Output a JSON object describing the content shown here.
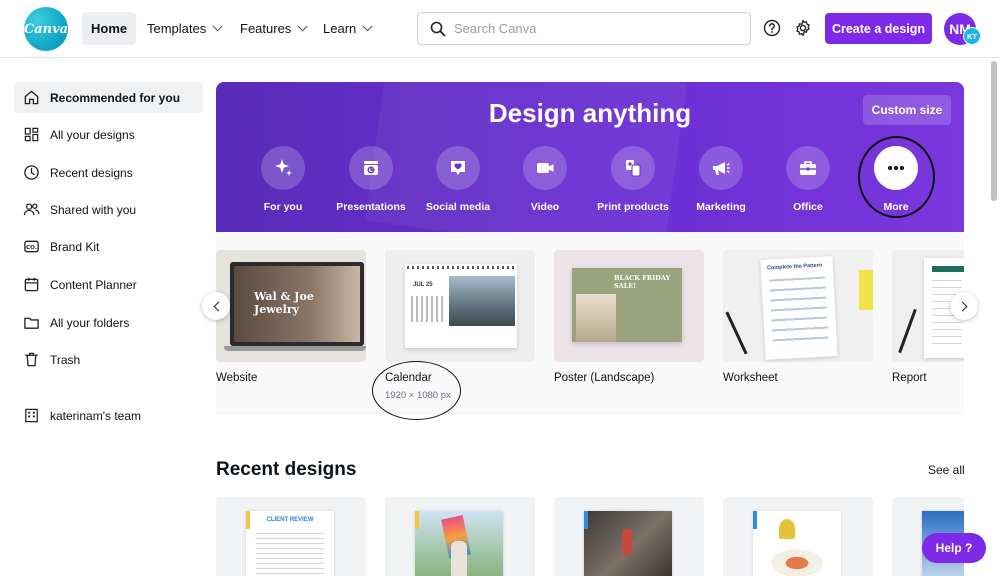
{
  "brand": {
    "logo_text": "Canva",
    "accent": "#7d2ae8"
  },
  "nav": {
    "home": "Home",
    "templates": "Templates",
    "features": "Features",
    "learn": "Learn"
  },
  "search": {
    "placeholder": "Search Canva",
    "value": ""
  },
  "header": {
    "create_label": "Create a design",
    "avatar_initials": "NM",
    "avatar_badge": "KT"
  },
  "sidebar": {
    "items": [
      {
        "label": "Recommended for you",
        "icon": "home-icon"
      },
      {
        "label": "All your designs",
        "icon": "grid-icon"
      },
      {
        "label": "Recent designs",
        "icon": "clock-icon"
      },
      {
        "label": "Shared with you",
        "icon": "people-icon"
      },
      {
        "label": "Brand Kit",
        "icon": "brand-kit-icon"
      },
      {
        "label": "Content Planner",
        "icon": "calendar-icon"
      },
      {
        "label": "All your folders",
        "icon": "folder-icon"
      },
      {
        "label": "Trash",
        "icon": "trash-icon"
      }
    ],
    "team": "katerinam's team"
  },
  "banner": {
    "title": "Design anything",
    "custom_size": "Custom size",
    "categories": [
      {
        "label": "For you",
        "icon": "sparkle-icon"
      },
      {
        "label": "Presentations",
        "icon": "presentation-icon"
      },
      {
        "label": "Social media",
        "icon": "heart-chat-icon"
      },
      {
        "label": "Video",
        "icon": "video-camera-icon"
      },
      {
        "label": "Print products",
        "icon": "print-icon"
      },
      {
        "label": "Marketing",
        "icon": "megaphone-icon"
      },
      {
        "label": "Office",
        "icon": "briefcase-icon"
      },
      {
        "label": "More",
        "icon": "more-dots-icon"
      }
    ]
  },
  "templates": [
    {
      "name": "Website",
      "dims": "",
      "thumb_text": "Wal & Joe Jewelry"
    },
    {
      "name": "Calendar",
      "dims": "1920 × 1080 px",
      "thumb_text": "JUL 25"
    },
    {
      "name": "Poster (Landscape)",
      "dims": "",
      "thumb_text": "BLACK FRIDAY SALE!"
    },
    {
      "name": "Worksheet",
      "dims": "",
      "thumb_text": "Complete the Pattern"
    },
    {
      "name": "Report",
      "dims": "",
      "thumb_text": ""
    }
  ],
  "recent": {
    "title": "Recent designs",
    "see_all": "See all",
    "first_thumb_text": "CLIENT REVIEW"
  },
  "help": {
    "label": "Help ?"
  }
}
